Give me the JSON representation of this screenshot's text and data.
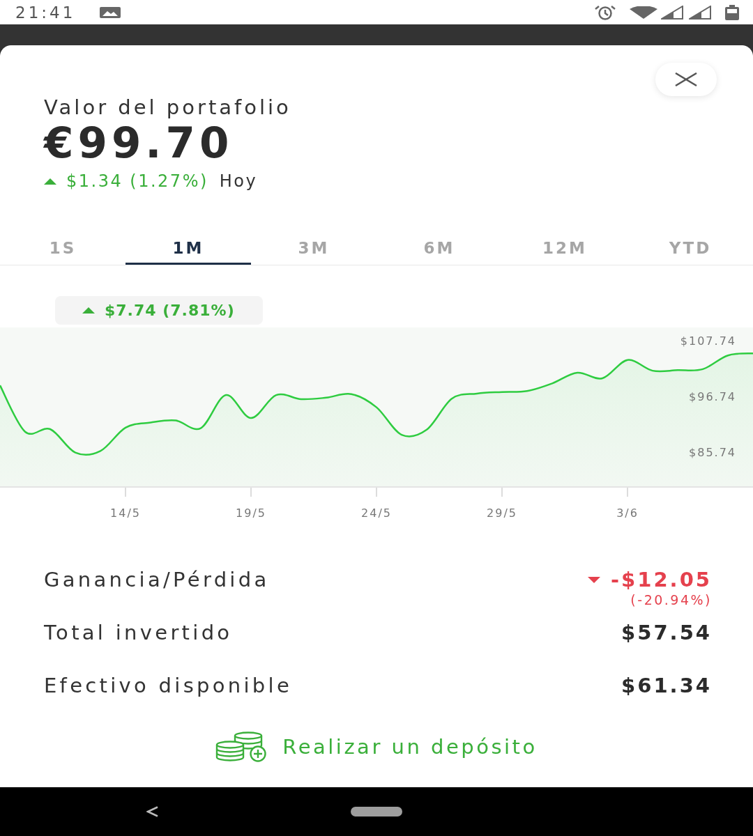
{
  "status_bar": {
    "time": "21:41"
  },
  "sheet": {
    "title": "Valor del portafolio",
    "value": "€99.70",
    "today_change": {
      "rising": true,
      "amount": "$1.34 (1.27%)",
      "label": "Hoy"
    },
    "tabs": [
      {
        "label": "1S",
        "selected": false
      },
      {
        "label": "1M",
        "selected": true
      },
      {
        "label": "3M",
        "selected": false
      },
      {
        "label": "6M",
        "selected": false
      },
      {
        "label": "12M",
        "selected": false
      },
      {
        "label": "YTD",
        "selected": false
      }
    ],
    "period_change": {
      "rising": true,
      "amount": "$7.74 (7.81%)"
    },
    "chart_data": {
      "type": "area",
      "categories": [
        null,
        null,
        null,
        null,
        null,
        "14/5",
        null,
        null,
        null,
        null,
        "19/5",
        null,
        null,
        null,
        null,
        "24/5",
        null,
        null,
        null,
        null,
        "29/5",
        null,
        null,
        null,
        null,
        "3/6",
        null,
        null,
        null,
        null,
        null
      ],
      "ylim": [
        79,
        110.5
      ],
      "yticks": [
        {
          "value": 85.74,
          "label": "$85.74"
        },
        {
          "value": 96.74,
          "label": "$96.74"
        },
        {
          "value": 107.74,
          "label": "$107.74"
        }
      ],
      "series": [
        {
          "color": "#2ecc40",
          "values": [
            99.1,
            90.0,
            90.5,
            85.9,
            86.2,
            90.8,
            91.8,
            92.2,
            90.7,
            97.2,
            92.7,
            97.2,
            96.4,
            96.7,
            97.4,
            94.8,
            89.4,
            90.4,
            96.5,
            97.5,
            97.8,
            98.0,
            99.5,
            101.6,
            100.5,
            104.1,
            102.0,
            102.1,
            102.3,
            105.0,
            105.4
          ]
        }
      ]
    },
    "stats": [
      {
        "kind": "change",
        "label": "Ganancia/Pérdida",
        "rising": false,
        "value": "-$12.05",
        "sub_value": "(-20.94%)"
      },
      {
        "kind": "amount",
        "label": "Total invertido",
        "value": "$57.54"
      },
      {
        "kind": "amount",
        "label": "Efectivo disponible",
        "value": "$61.34"
      }
    ],
    "deposit_link": {
      "label": "Realizar un depósito"
    }
  }
}
